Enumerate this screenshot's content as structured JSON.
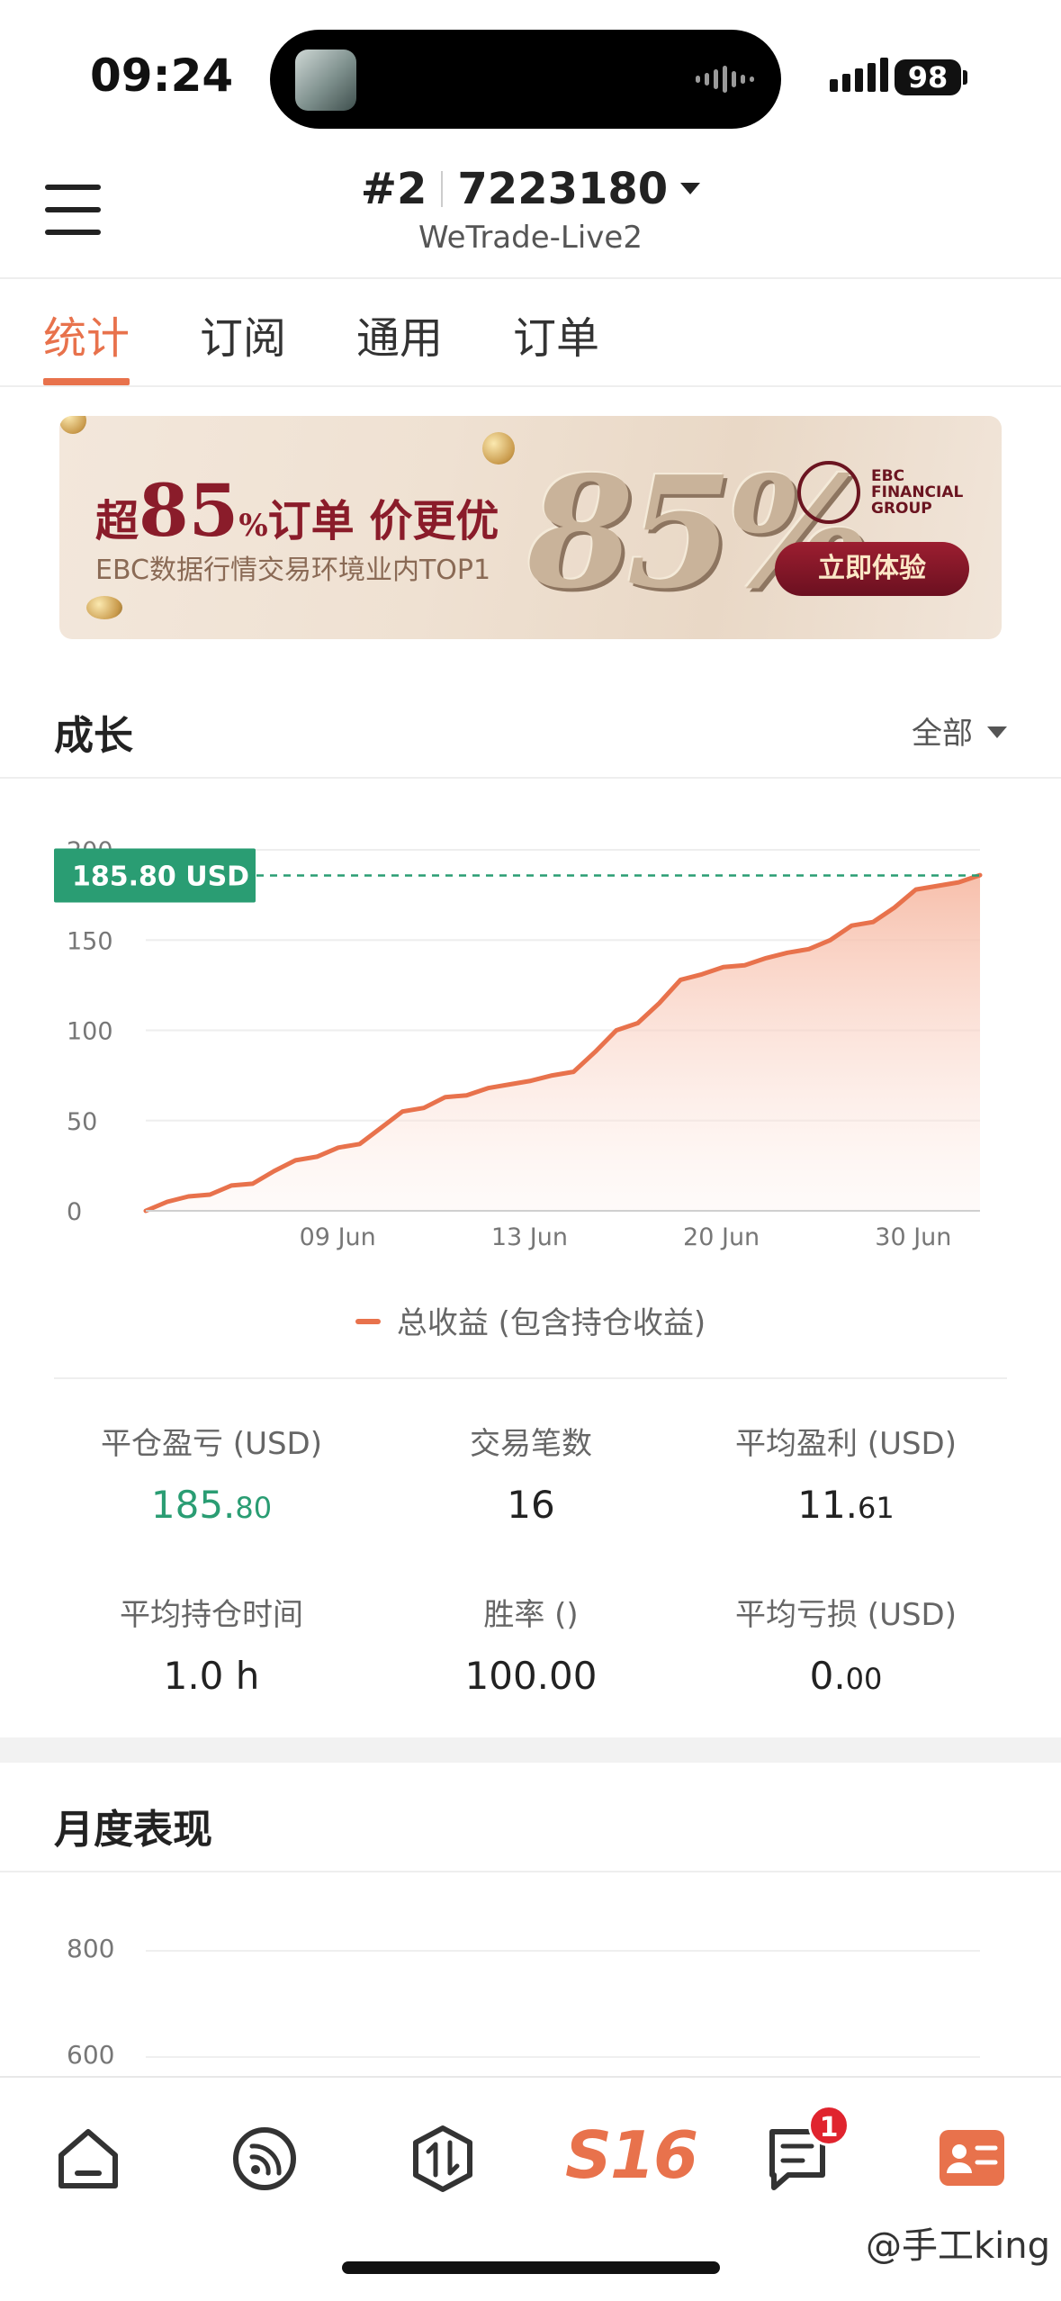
{
  "status_bar": {
    "time": "09:24",
    "battery": "98"
  },
  "header": {
    "account_tag": "#2",
    "account_id": "7223180",
    "server": "WeTrade-Live2"
  },
  "tabs": [
    {
      "label": "统计",
      "active": true
    },
    {
      "label": "订阅",
      "active": false
    },
    {
      "label": "通用",
      "active": false
    },
    {
      "label": "订单",
      "active": false
    }
  ],
  "banner": {
    "headline_pre": "超",
    "headline_big": "85",
    "headline_pct": "%",
    "headline_post": "订单 价更优",
    "subtitle": "EBC数据行情交易环境业内TOP1",
    "big_number": "85%",
    "logo_text": [
      "EBC",
      "FINANCIAL",
      "GROUP"
    ],
    "cta": "立即体验"
  },
  "growth": {
    "title": "成长",
    "filter": "全部",
    "current_value_label": "185.80 USD",
    "legend": "总收益 (包含持仓收益)"
  },
  "chart_data": {
    "type": "area",
    "series": [
      {
        "name": "总收益 (包含持仓收益)",
        "values": [
          0,
          5,
          8,
          9,
          14,
          15,
          22,
          28,
          30,
          35,
          37,
          46,
          55,
          57,
          63,
          64,
          68,
          70,
          72,
          75,
          77,
          88,
          100,
          104,
          115,
          128,
          131,
          135,
          136,
          140,
          143,
          145,
          150,
          158,
          160,
          168,
          178,
          180,
          182,
          186
        ]
      }
    ],
    "x_tick_labels": [
      "09 Jun",
      "13 Jun",
      "20 Jun",
      "30 Jun"
    ],
    "y_ticks": [
      0,
      50,
      100,
      150,
      200
    ],
    "ylim": [
      0,
      200
    ],
    "current_value": 185.8,
    "colors": {
      "line": "#e8724c",
      "fill_top": "#f6b8a2",
      "marker": "#2a9d73"
    }
  },
  "stats": [
    {
      "label": "平仓盈亏 (USD)",
      "value_int": "185.",
      "value_dec": "80",
      "color": "green"
    },
    {
      "label": "交易笔数",
      "value_int": "16",
      "value_dec": "",
      "color": "default"
    },
    {
      "label": "平均盈利 (USD)",
      "value_int": "11.",
      "value_dec": "61",
      "color": "default"
    },
    {
      "label": "平均持仓时间",
      "value_int": "1.0 h",
      "value_dec": "",
      "color": "default"
    },
    {
      "label": "胜率 ()",
      "value_int": "100.00",
      "value_dec": "",
      "color": "default"
    },
    {
      "label": "平均亏损 (USD)",
      "value_int": "0.",
      "value_dec": "00",
      "color": "default"
    }
  ],
  "monthly": {
    "title": "月度表现",
    "y_ticks": [
      "800",
      "600"
    ]
  },
  "bottom_nav": {
    "items": [
      "home-icon",
      "feed-icon",
      "trade-icon",
      "s16-tab",
      "messages-icon",
      "profile-icon"
    ],
    "s16_label": "S16",
    "badge": "1"
  },
  "watermark": "@手工king",
  "colors": {
    "accent": "#e8724c",
    "positive": "#2a9d73",
    "badge": "#e0242e"
  }
}
